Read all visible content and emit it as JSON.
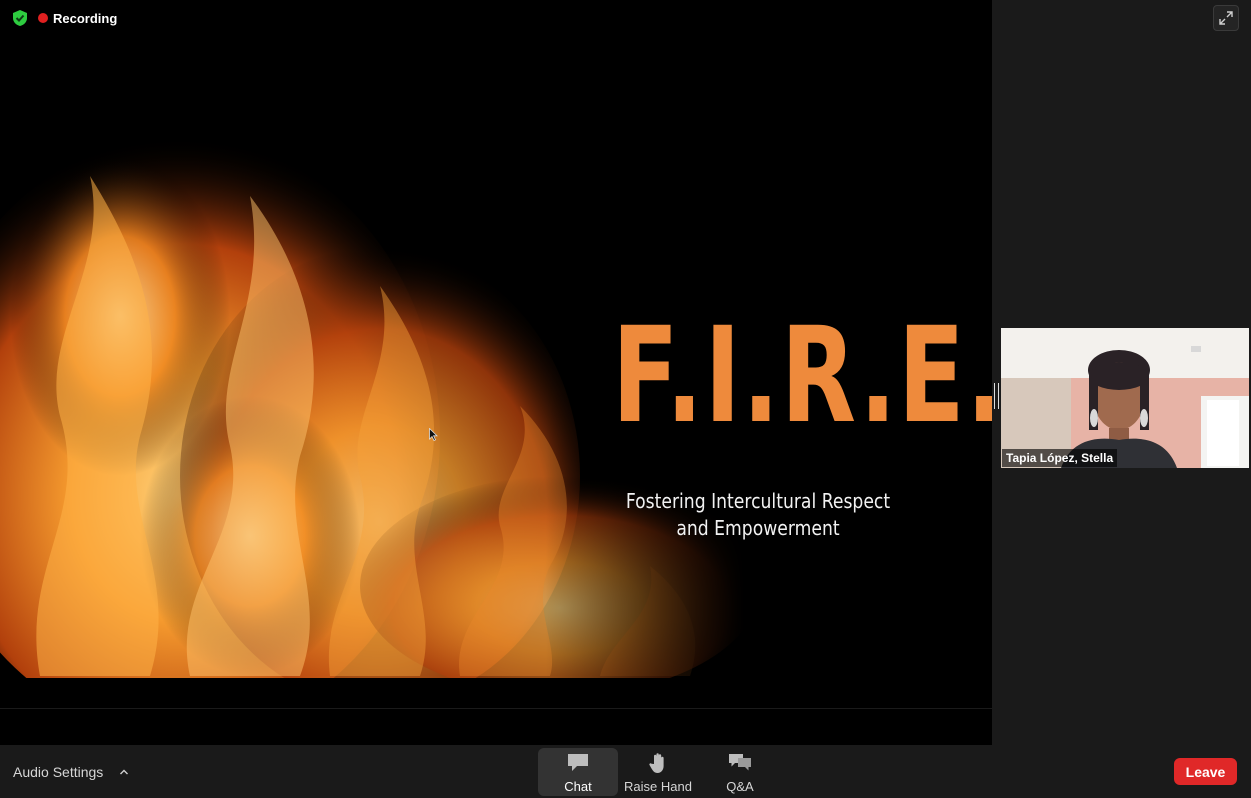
{
  "status": {
    "recording_label": "Recording"
  },
  "slide": {
    "title": "F.I.R.E.",
    "subtitle_line1": "Fostering Intercultural Respect",
    "subtitle_line2": "and Empowerment"
  },
  "participant": {
    "name": "Tapia López, Stella"
  },
  "toolbar": {
    "audio_settings_label": "Audio Settings",
    "chat_label": "Chat",
    "raise_hand_label": "Raise Hand",
    "qa_label": "Q&A",
    "leave_label": "Leave"
  },
  "colors": {
    "accent_orange": "#ee8a3c",
    "recording_red": "#e02020",
    "leave_red": "#e02828",
    "shield_green": "#2ecc40"
  },
  "icons": [
    "shield-icon",
    "recording-dot-icon",
    "fullscreen-icon",
    "caret-up-icon",
    "chat-icon",
    "raise-hand-icon",
    "qa-icon",
    "cursor-icon"
  ]
}
